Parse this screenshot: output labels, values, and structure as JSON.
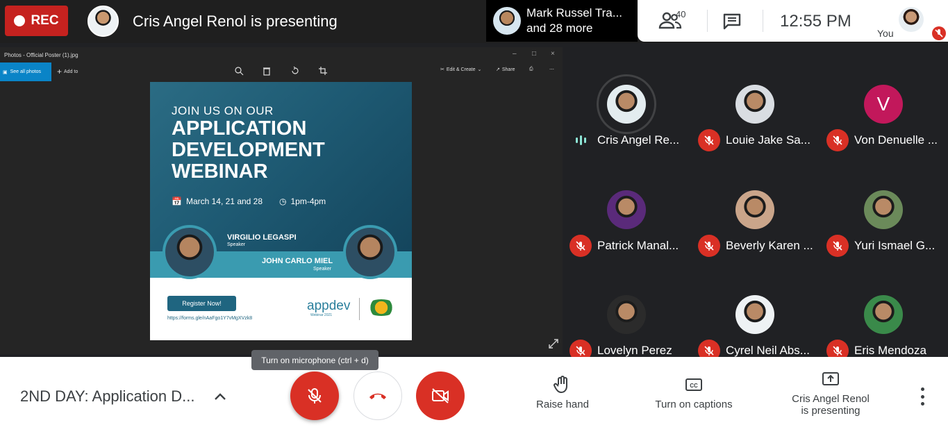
{
  "top": {
    "rec_label": "REC",
    "presenting_title": "Cris Angel Renol is presenting",
    "more_participants_name": "Mark Russel Tra...",
    "more_participants_count": "and 28 more",
    "people_count": "40",
    "time": "12:55 PM",
    "you_label": "You"
  },
  "presentation": {
    "window_title": "Photos - Official Poster (1).jpg",
    "see_all": "See all photos",
    "add_to": "Add to",
    "edit_create": "Edit & Create",
    "share": "Share",
    "poster": {
      "join": "JOIN US ON OUR",
      "line1": "APPLICATION",
      "line2": "DEVELOPMENT",
      "line3": "WEBINAR",
      "date": "March 14, 21 and 28",
      "time": "1pm-4pm",
      "speaker1_name": "VIRGILIO LEGASPI",
      "speaker1_role": "Speaker",
      "speaker2_name": "JOHN CARLO MIEL",
      "speaker2_role": "Speaker",
      "register": "Register Now!",
      "url": "https://forms.gle/nAaFgo1Y7vMgXVzk8",
      "brand": "appdev",
      "brand_sub": "Webinar 2021"
    }
  },
  "participants": [
    {
      "name": "Cris Angel Re...",
      "status": "speaking",
      "avatar_color": "#e3ecef"
    },
    {
      "name": "Louie Jake Sa...",
      "status": "muted",
      "avatar_color": "#d9dde2"
    },
    {
      "name": "Von Denuelle ...",
      "status": "muted",
      "initial": "V",
      "avatar_color": "#c2185b"
    },
    {
      "name": "Patrick Manal...",
      "status": "muted",
      "avatar_color": "#5a2a7a"
    },
    {
      "name": "Beverly Karen ...",
      "status": "muted",
      "avatar_color": "#caa58a"
    },
    {
      "name": "Yuri Ismael G...",
      "status": "muted",
      "avatar_color": "#6b8a5a"
    },
    {
      "name": "Lovelyn Perez",
      "status": "muted",
      "avatar_color": "#2b2b2b"
    },
    {
      "name": "Cyrel Neil Abs...",
      "status": "muted",
      "avatar_color": "#eef2f4"
    },
    {
      "name": "Eris Mendoza",
      "status": "muted",
      "avatar_color": "#3a8a4a"
    }
  ],
  "bottom": {
    "meeting_title": "2ND DAY: Application D...",
    "tooltip": "Turn on microphone (ctrl + d)",
    "raise_hand": "Raise hand",
    "captions": "Turn on captions",
    "presenting_line1": "Cris Angel Renol",
    "presenting_line2": "is presenting"
  },
  "colors": {
    "accent_red": "#d93025",
    "rec_red": "#c5221f",
    "speaking_teal": "#8ee5d6"
  }
}
